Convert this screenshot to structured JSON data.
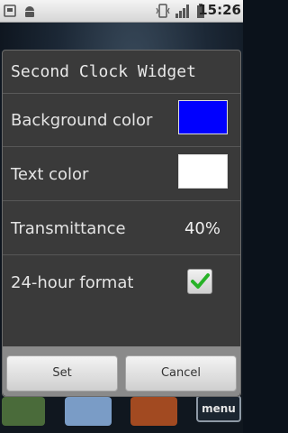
{
  "status_bar": {
    "time": "15:26",
    "icons": [
      "usb-icon",
      "android-debug-icon",
      "vibrate-icon",
      "signal-icon",
      "battery-icon"
    ]
  },
  "dialog": {
    "title": "Second Clock Widget",
    "rows": {
      "background_color": {
        "label": "Background color",
        "color": "#0000ff"
      },
      "text_color": {
        "label": "Text color",
        "color": "#ffffff"
      },
      "transmittance": {
        "label": "Transmittance",
        "value": "40%"
      },
      "hour_format": {
        "label": "24-hour format",
        "checked": true
      }
    },
    "buttons": {
      "set": "Set",
      "cancel": "Cancel"
    }
  },
  "dock": {
    "menu_label": "menu"
  },
  "colors": {
    "check": "#27b227"
  }
}
